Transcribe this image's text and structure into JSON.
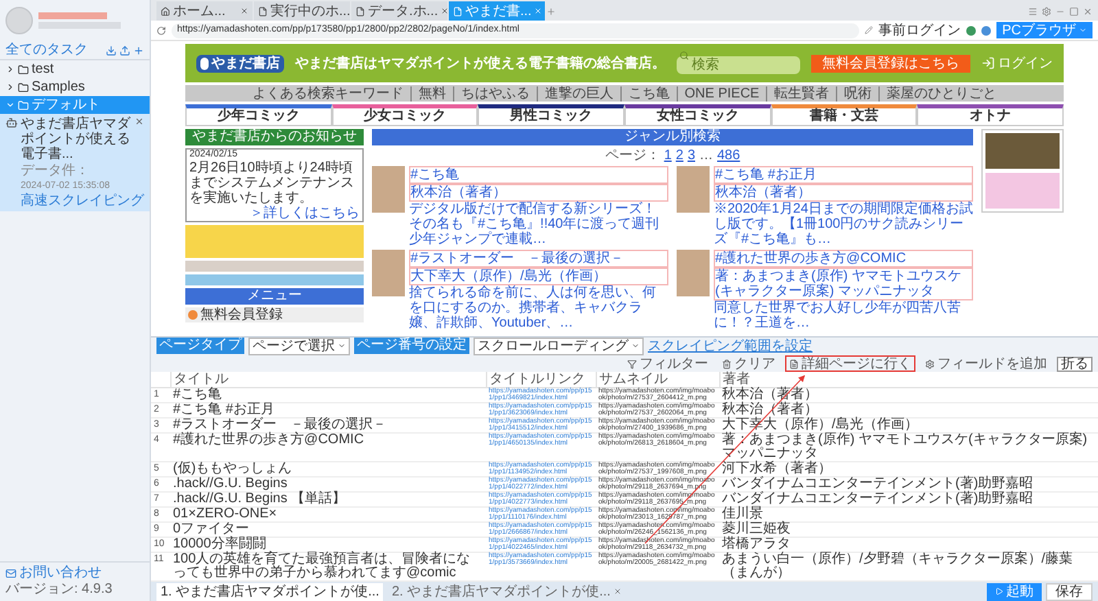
{
  "sidebar": {
    "header_title": "全てのタスク",
    "folders": [
      {
        "name": "test",
        "expanded": false,
        "selected": false
      },
      {
        "name": "Samples",
        "expanded": false,
        "selected": false
      },
      {
        "name": "デフォルト",
        "expanded": true,
        "selected": true,
        "tasks": [
          {
            "title": "やまだ書店ヤマダポイントが使える電子書...",
            "data_label": "データ件：",
            "date": "2024-07-02 15:35:08",
            "mode": "高速スクレイピング"
          }
        ]
      }
    ],
    "contact": "お問い合わせ",
    "version": "バージョン: 4.9.3"
  },
  "browser": {
    "tabs": [
      {
        "label": "ホーム...",
        "kind": "home",
        "selected": false
      },
      {
        "label": "実行中のホ...",
        "kind": "page",
        "selected": false
      },
      {
        "label": "データ.ホ...",
        "kind": "page",
        "selected": false
      },
      {
        "label": "やまだ書...",
        "kind": "page",
        "selected": true
      }
    ],
    "url": "https://yamadashoten.com/pp/p173580/pp1/2800/pp2/2802/pageNo/1/index.html",
    "login": "事前ログイン",
    "mode_button": "PCブラウザ"
  },
  "site": {
    "logo_text": "やまだ書店",
    "tagline": "やまだ書店はヤマダポイントが使える電子書籍の総合書店。",
    "search_placeholder": "検索",
    "register": "無料会員登録はこちら",
    "login": "ログイン",
    "keyword_label": "よくある検索キーワード",
    "keywords": [
      "無料",
      "ちはやふる",
      "進撃の巨人",
      "こち亀",
      "ONE PIECE",
      "転生賢者",
      "呪術",
      "薬屋のひとりごと"
    ],
    "categories": [
      {
        "label": "少年コミック",
        "color": "#3d6fd6"
      },
      {
        "label": "少女コミック",
        "color": "#e8609c"
      },
      {
        "label": "男性コミック",
        "color": "#1f2a80"
      },
      {
        "label": "女性コミック",
        "color": "#6a3aa0"
      },
      {
        "label": "書籍・文芸",
        "color": "#f08a3c"
      },
      {
        "label": "オトナ",
        "color": "#8e4fb0"
      }
    ],
    "notice": {
      "title": "やまだ書店からのお知らせ",
      "date": "2024/02/15",
      "text": "2月26日10時頃より24時頃までシステムメンテナンスを実施いたします。",
      "link": "＞詳しくはこちら"
    },
    "menu": {
      "title": "メニュー",
      "items": [
        "無料会員登録"
      ]
    },
    "genre_title": "ジャンル別検索",
    "pager": {
      "label": "ページ：",
      "pages": [
        "1",
        "2",
        "3"
      ],
      "ellipsis": "…",
      "last": "486"
    },
    "entries": [
      {
        "title": "#こち亀",
        "author": "秋本治（著者）",
        "desc": "デジタル版だけで配信する新シリーズ！その名も『#こち亀』!!40年に渡って週刊少年ジャンプで連載…"
      },
      {
        "title": "#こち亀 #お正月",
        "author": "秋本治（著者）",
        "desc": "※2020年1月24日までの期間限定価格お試し版です。【1冊100円のサク読みシリーズ『#こち亀』も…"
      },
      {
        "title": "#ラストオーダー　－最後の選択－",
        "author": "大下幸大（原作）/島光（作画）",
        "desc": "捨てられる命を前に、人は何を思い、何を口にするのか。携帯者、キャバクラ嬢、詐欺師、Youtuber、…"
      },
      {
        "title": "#護れた世界の歩き方@COMIC",
        "author": "著：あまつまき(原作) ヤマモトユウスケ(キャラクター原案) マッパニナッタ",
        "desc": "同意した世界でお人好し少年が四苦八苦に！？王道を…"
      }
    ]
  },
  "data_panel": {
    "collapse_button": "折る",
    "page_type_label": "ページタイプ",
    "page_type_value": "ページで選択",
    "page_number_label": "ページ番号の設定",
    "page_number_value": "スクロールローディング",
    "range_link": "スクレイピング範囲を設定",
    "tools": [
      {
        "label": "フィルター",
        "kind": "filter",
        "highlighted": false
      },
      {
        "label": "クリア",
        "kind": "clear",
        "highlighted": false
      },
      {
        "label": "詳細ページに行く",
        "kind": "detail",
        "highlighted": true
      },
      {
        "label": "フィールドを追加",
        "kind": "add",
        "highlighted": false
      }
    ],
    "columns": [
      "タイトル",
      "タイトルリンク",
      "サムネイル",
      "著者"
    ],
    "rows": [
      {
        "num": "1",
        "title": "#こち亀",
        "link": "https://yamadashoten.com/pp/p151/pp1/3469821/index.html",
        "thumb": "https://yamadashoten.com/img/moabook/photo/m/27537_2604412_m.png",
        "author": "秋本治（著者）"
      },
      {
        "num": "2",
        "title": "#こち亀 #お正月",
        "link": "https://yamadashoten.com/pp/p151/pp1/3623069/index.html",
        "thumb": "https://yamadashoten.com/img/moabook/photo/m/27537_2602064_m.png",
        "author": "秋本治（著者）"
      },
      {
        "num": "3",
        "title": "#ラストオーダー　－最後の選択－",
        "link": "https://yamadashoten.com/pp/p151/pp1/3415512/index.html",
        "thumb": "https://yamadashoten.com/img/moabook/photo/m/27400_1939686_m.png",
        "author": "大下幸大（原作）/島光（作画）"
      },
      {
        "num": "4",
        "title": "#護れた世界の歩き方@COMIC",
        "link": "https://yamadashoten.com/pp/p151/pp1/4650135/index.html",
        "thumb": "https://yamadashoten.com/img/moabook/photo/m/26813_2618604_m.png",
        "author": "著：あまつまき(原作) ヤマモトユウスケ(キャラクター原案) マッパニナッタ"
      },
      {
        "num": "5",
        "title": "(仮)ももやっしょん",
        "link": "https://yamadashoten.com/pp/p151/pp1/1134952/index.html",
        "thumb": "https://yamadashoten.com/img/moabook/photo/m/27537_1997608_m.png",
        "author": "河下水希（著者）"
      },
      {
        "num": "6",
        "title": ".hack//G.U. Begins",
        "link": "https://yamadashoten.com/pp/p151/pp1/4022772/index.html",
        "thumb": "https://yamadashoten.com/img/moabook/photo/m/29118_2637694_m.png",
        "author": "バンダイナムコエンターテインメント(著)助野嘉昭"
      },
      {
        "num": "7",
        "title": ".hack//G.U. Begins 【単話】",
        "link": "https://yamadashoten.com/pp/p151/pp1/4022773/index.html",
        "thumb": "https://yamadashoten.com/img/moabook/photo/m/29118_2637695_m.png",
        "author": "バンダイナムコエンターテインメント(著)助野嘉昭"
      },
      {
        "num": "8",
        "title": "01×ZERO-ONE×",
        "link": "https://yamadashoten.com/pp/p151/pp1/1110176/index.html",
        "thumb": "https://yamadashoten.com/img/moabook/photo/m/23013_1629787_m.png",
        "author": "佳川景"
      },
      {
        "num": "9",
        "title": "0ファイター",
        "link": "https://yamadashoten.com/pp/p151/pp1/2666867/index.html",
        "thumb": "https://yamadashoten.com/img/moabook/photo/m/26246_1562136_m.png",
        "author": "菱川三姫夜"
      },
      {
        "num": "10",
        "title": "10000分率闘闘",
        "link": "https://yamadashoten.com/pp/p151/pp1/4022465/index.html",
        "thumb": "https://yamadashoten.com/img/moabook/photo/m/29118_2634732_m.png",
        "author": "塔橋アラタ"
      },
      {
        "num": "11",
        "title": "100人の英雄を育てた最強預言者は、冒険者になっても世界中の弟子から慕われてます@comic",
        "link": "https://yamadashoten.com/pp/p151/pp1/3573669/index.html",
        "thumb": "https://yamadashoten.com/img/moabook/photo/m/20005_2681422_m.png",
        "author": "あまうい白一（原作）/夕野碧（キャラクター原案）/藤葉（まんが）"
      }
    ]
  },
  "task_tabs": [
    {
      "label": "1. やまだ書店ヤマダポイントが使...",
      "selected": true,
      "closable": false
    },
    {
      "label": "2. やまだ書店ヤマダポイントが使...",
      "selected": false,
      "closable": true
    }
  ],
  "buttons": {
    "start": "起動",
    "save": "保存"
  }
}
